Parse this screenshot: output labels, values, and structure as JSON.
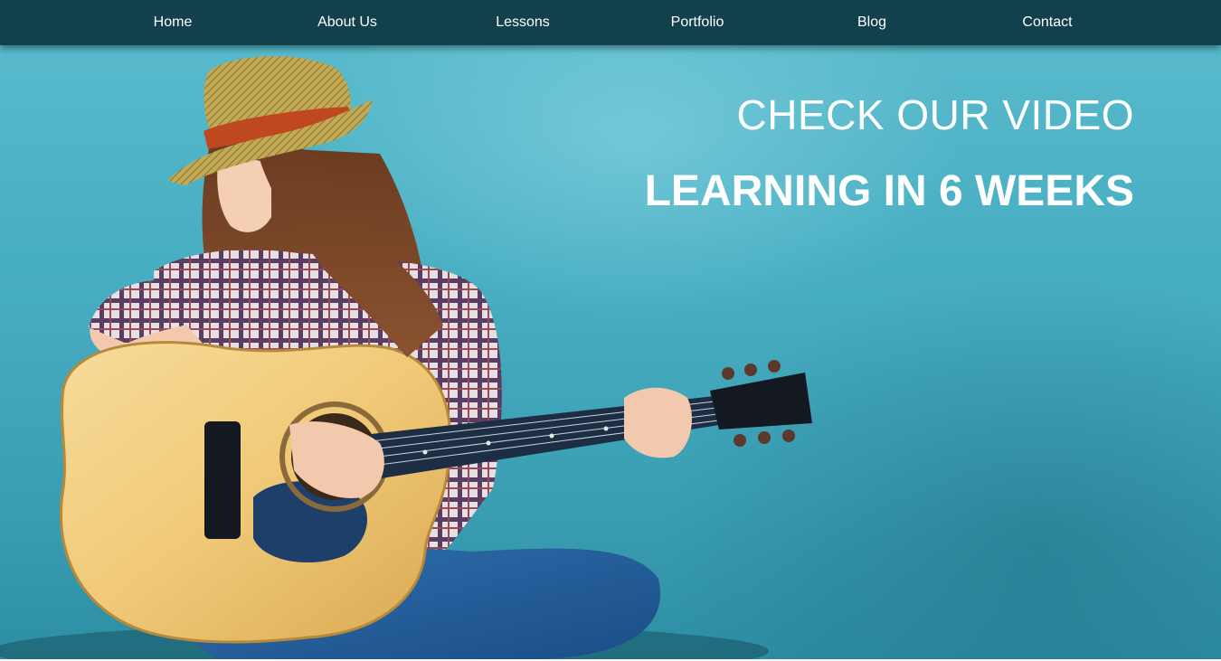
{
  "nav": {
    "items": [
      {
        "label": "Home"
      },
      {
        "label": "About Us"
      },
      {
        "label": "Lessons"
      },
      {
        "label": "Portfolio"
      },
      {
        "label": "Blog"
      },
      {
        "label": "Contact"
      }
    ]
  },
  "hero": {
    "headline_primary": "CHECK OUR VIDEO",
    "headline_secondary": "LEARNING IN 6 WEEKS",
    "image_subject": "girl-playing-acoustic-guitar"
  },
  "colors": {
    "navbar_bg": "#13404d",
    "wall": "#48aec2",
    "text": "#ffffff"
  }
}
